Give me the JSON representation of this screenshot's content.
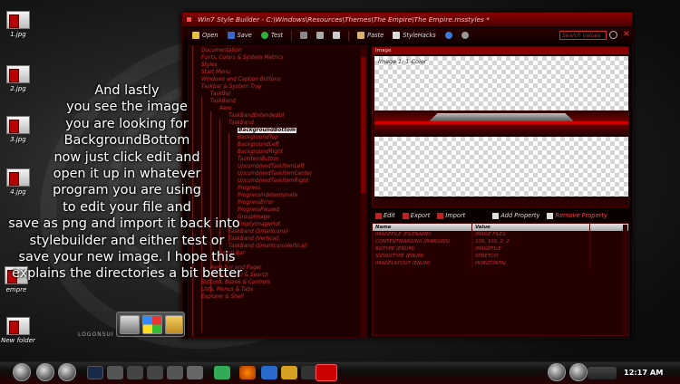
{
  "desktop": {
    "icons": [
      {
        "label": "1.jpg"
      },
      {
        "label": "2.jpg"
      },
      {
        "label": "3.jpg"
      },
      {
        "label": "4.jpg"
      },
      {
        "label": "empre"
      },
      {
        "label": "New folder"
      }
    ]
  },
  "caption": {
    "lines": [
      "And lastly",
      "you see the image",
      "you are looking for",
      "BackgroundBottom",
      "now just click edit and",
      "open it up in whatever",
      "program you are using",
      "to edit your file and",
      "save as png and import it back into",
      "stylebuilder and either test or",
      "save your new image. I hope this",
      "explains the directories a bit better"
    ]
  },
  "window": {
    "title": "Win7 Style Builder - C:\\Windows\\Resources\\Themes\\The Empire\\The Empire.msstyles *",
    "toolbar": {
      "open": "Open",
      "save": "Save",
      "test": "Test",
      "paste": "Paste",
      "stylehacks": "StyleHacks"
    },
    "search_placeholder": "Search Values",
    "tree": {
      "items": [
        "Documentation",
        "Fonts, Colors & System Metrics",
        "Styles",
        "Start Menu",
        "Windows and Caption Buttons",
        "Taskbar & System Tray",
        "TaskBar",
        "TaskBand",
        "Aero",
        "TaskBandExtendedUI",
        "TaskBand",
        "BackgroundBottom",
        "BackgroundTop",
        "BackgroundLeft",
        "BackgroundRight",
        "TaskItemButton",
        "UncombinedTaskItemLeft",
        "UncombinedTaskItemCenter",
        "UncombinedTaskItemRight",
        "Progress",
        "ProgressIndeterminate",
        "ProgressError",
        "ProgressPaused",
        "GroupImage",
        "EmptyImageHot",
        "TaskBand (SmallIcons)",
        "TaskBand (Vertical)",
        "TaskBand (SmallIconsVertical)",
        "Scroll Bar",
        "Tray",
        "Aero Bar and Pager",
        "Breadcrumb & Search",
        "Buttons, Boxes & Controls",
        "Lists, Menus & Tabs",
        "Explorer & Shell"
      ]
    },
    "image_pane": {
      "header": "Image",
      "checker_label": "Image 1: 1-Color"
    },
    "property_bar": {
      "edit": "Edit",
      "export": "Export",
      "import": "Import",
      "add_property": "Add Property",
      "remove_property": "Remove Property"
    },
    "props_table": {
      "headers": [
        "Name",
        "Value"
      ],
      "rows": [
        [
          "IMAGEFILE (FILENAME)",
          "IMAGE FILE1"
        ],
        [
          "CONTENTMARGINS (MARGINS)",
          "100, 100, 2, 2"
        ],
        [
          "BGTYPE (ENUM)",
          "IMAGEFILE"
        ],
        [
          "SIZINGTYPE (ENUM)",
          "STRETCH"
        ],
        [
          "IMAGELAYOUT (ENUM)",
          "HORIZONTAL"
        ]
      ]
    }
  },
  "launcher": {
    "label": "LOGONSUI"
  },
  "taskbar": {
    "clock": "12:17 AM"
  },
  "colors": {
    "accent": "#c53030",
    "window_bg": "#0a0000",
    "selection": "#e8e8e8"
  }
}
